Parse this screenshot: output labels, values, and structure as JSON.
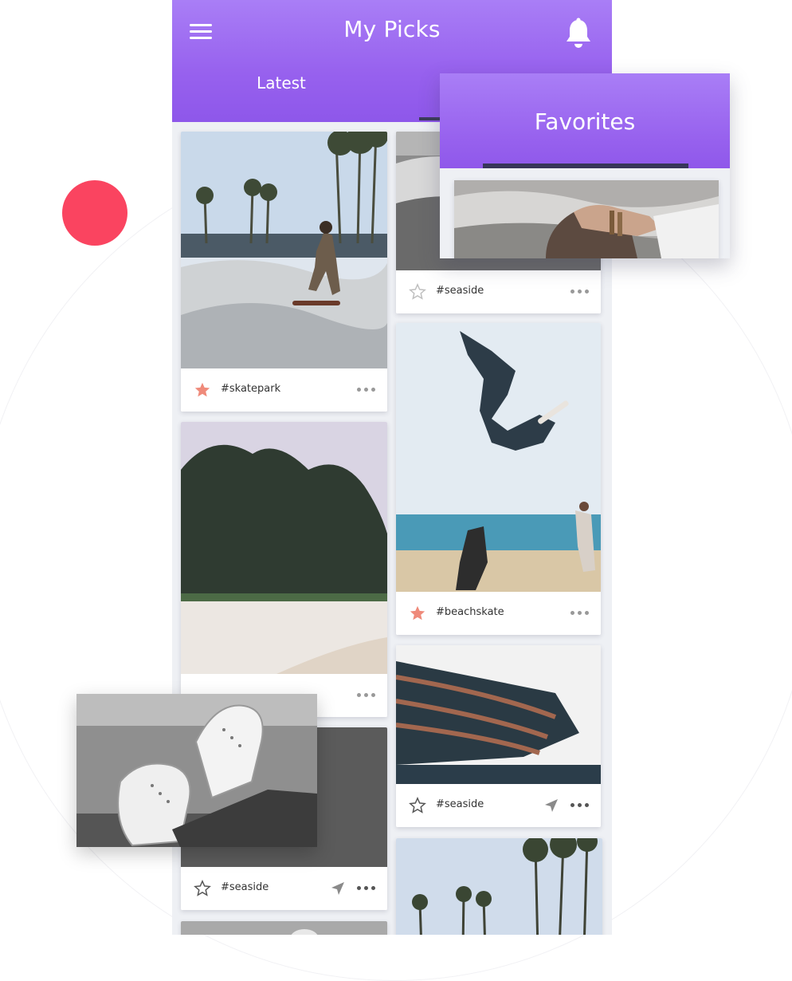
{
  "app": {
    "title": "My Picks",
    "icons": {
      "menu": "hamburger-menu-icon",
      "notifications": "bell-icon"
    }
  },
  "tabs": {
    "latest": "Latest",
    "favorites": "Favorites"
  },
  "cards": {
    "c1": {
      "tag": "#skatepark",
      "favorited": true
    },
    "c2": {
      "tag": "#seaside",
      "favorited": false
    },
    "c3": {
      "tag": "#beachskate",
      "favorited": true
    },
    "c4": {
      "tag": "#seaside",
      "favorited": false
    },
    "c5": {
      "tag": "#seaside",
      "favorited": false
    }
  },
  "colors": {
    "header_gradient_top": "#a97ef6",
    "header_gradient_bottom": "#8e57ea",
    "accent_red": "#fa4460",
    "favorite_star": "#ef8a7a"
  }
}
